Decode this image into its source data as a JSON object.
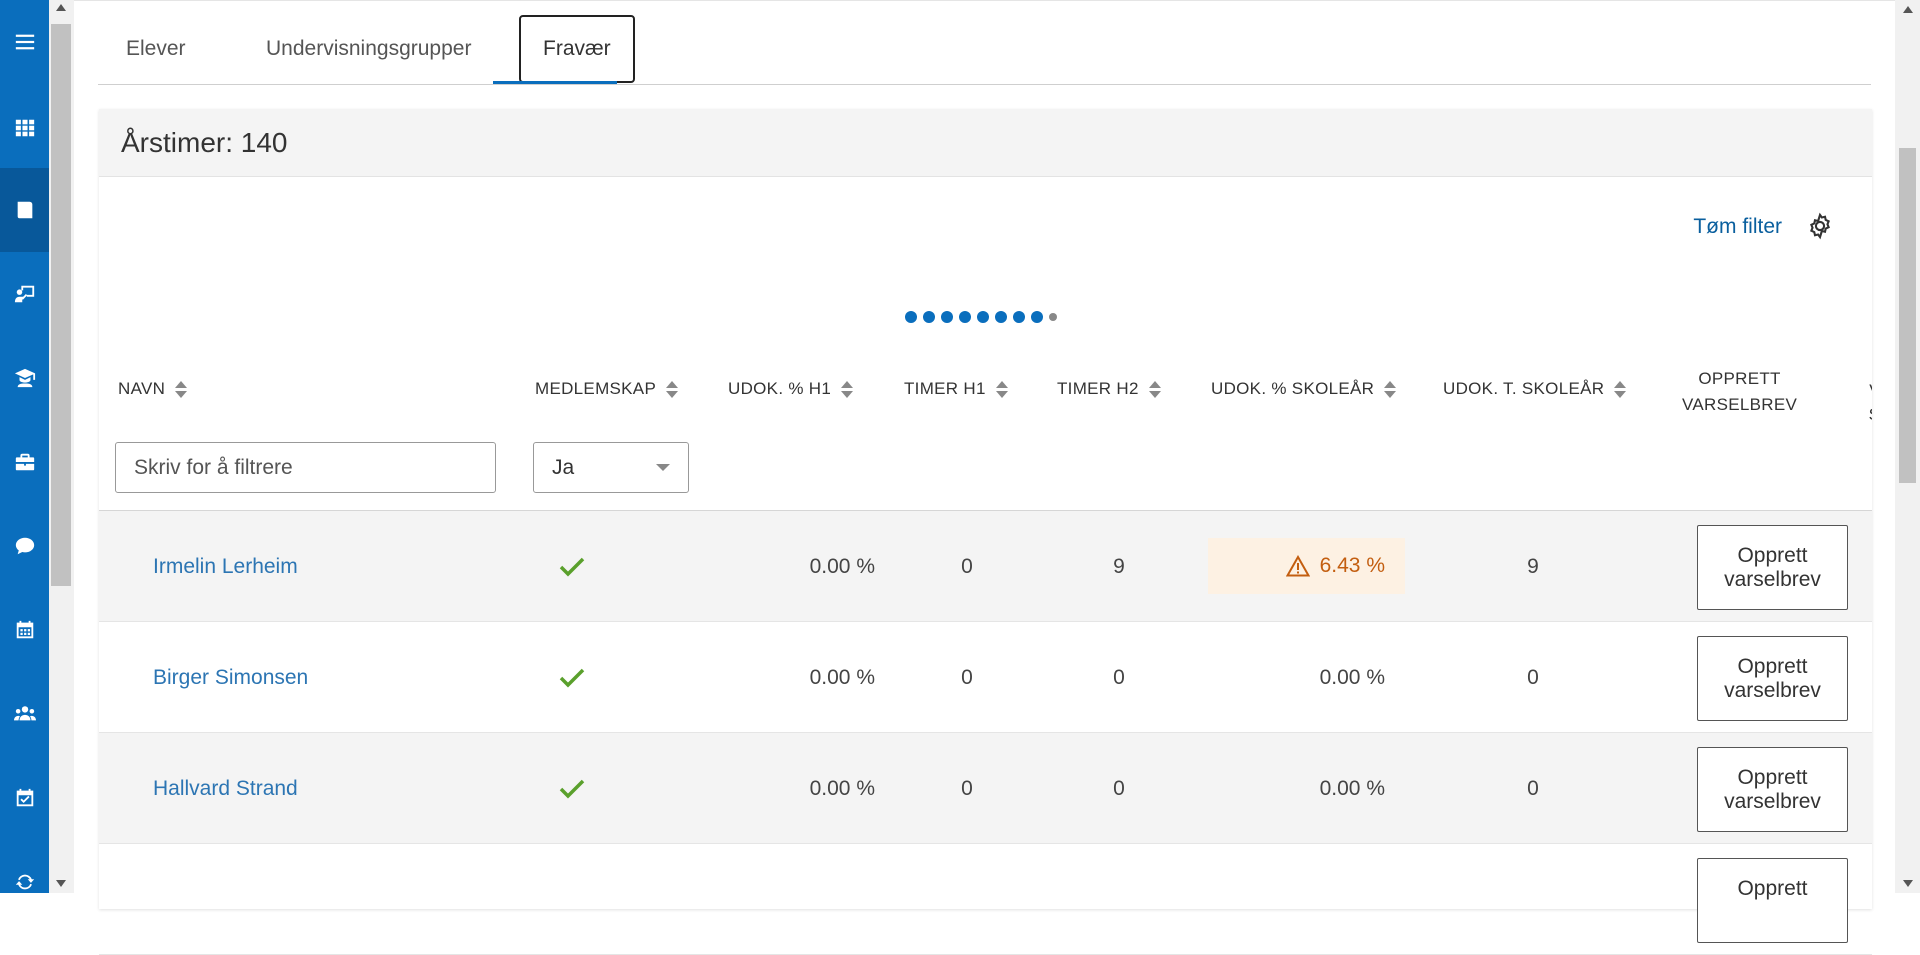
{
  "sidebar": {
    "items": [
      {
        "icon": "menu-icon",
        "active": false
      },
      {
        "icon": "grid-icon",
        "active": false
      },
      {
        "icon": "book-icon",
        "active": true
      },
      {
        "icon": "teacher-board-icon",
        "active": false
      },
      {
        "icon": "student-icon",
        "active": false
      },
      {
        "icon": "briefcase-icon",
        "active": false
      },
      {
        "icon": "chat-icon",
        "active": false
      },
      {
        "icon": "calendar-icon",
        "active": false
      },
      {
        "icon": "users-icon",
        "active": false
      },
      {
        "icon": "calendar-check-icon",
        "active": false
      },
      {
        "icon": "sync-icon",
        "active": false
      }
    ]
  },
  "tabs": [
    {
      "label": "Elever",
      "active": false
    },
    {
      "label": "Undervisningsgrupper",
      "active": false
    },
    {
      "label": "Fravær",
      "active": true
    }
  ],
  "panel": {
    "title": "Årstimer: 140",
    "clear_filter": "Tøm filter"
  },
  "columns": {
    "name": "NAVN",
    "membership": "MEDLEMSKAP",
    "udok_h1": "UDOK. % H1",
    "timer_h1": "TIMER H1",
    "timer_h2": "TIMER H2",
    "udok_year": "UDOK. % SKOLEÅR",
    "udok_t_year": "UDOK. T. SKOLEÅR",
    "create_letter_1": "OPPRETT",
    "create_letter_2": "VARSELBREV",
    "clipped_1": "S",
    "clipped_2": "VA",
    "clipped_3": "SE"
  },
  "filters": {
    "name_placeholder": "Skriv for å filtrere",
    "membership_value": "Ja"
  },
  "rows": [
    {
      "name": "Irmelin Lerheim",
      "udok_h1": "0.00 %",
      "timer_h1": "0",
      "timer_h2": "9",
      "udok_year": "6.43 %",
      "udok_t_year": "9",
      "warn": true,
      "button": "Opprett varselbrev"
    },
    {
      "name": "Birger Simonsen",
      "udok_h1": "0.00 %",
      "timer_h1": "0",
      "timer_h2": "0",
      "udok_year": "0.00 %",
      "udok_t_year": "0",
      "warn": false,
      "button": "Opprett varselbrev"
    },
    {
      "name": "Hallvard Strand",
      "udok_h1": "0.00 %",
      "timer_h1": "0",
      "timer_h2": "0",
      "udok_year": "0.00 %",
      "udok_t_year": "0",
      "warn": false,
      "button": "Opprett varselbrev"
    }
  ],
  "partial_row": {
    "button": "Opprett"
  },
  "colors": {
    "brand": "#0a6ebd",
    "link": "#2c75b3",
    "check": "#5aa02c",
    "warning": "#c35e10",
    "warning_bg": "#fdf1e3"
  }
}
